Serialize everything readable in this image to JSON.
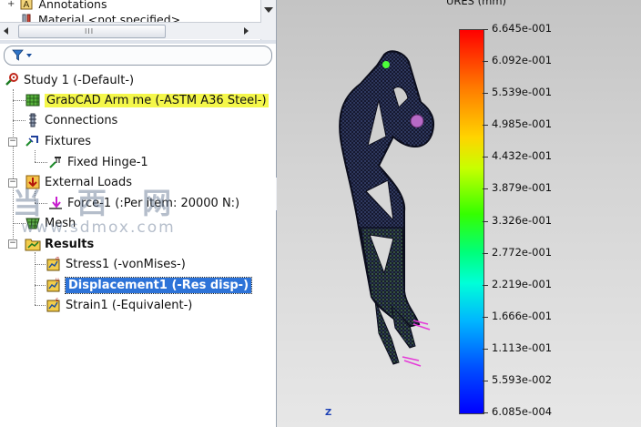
{
  "top_list": {
    "items": [
      {
        "label": "Annotations",
        "icon": "annotation-icon"
      },
      {
        "label": "Material <not specified>",
        "icon": "material-icon"
      }
    ],
    "hscroll_grip": "III"
  },
  "filter": {
    "icon": "filter-funnel-icon"
  },
  "tree": {
    "study": "Study 1 (-Default-)",
    "part": "GrabCAD Arm me (-ASTM A36 Steel-)",
    "connections": "Connections",
    "fixtures": "Fixtures",
    "fixed_hinge": "Fixed Hinge-1",
    "external_loads": "External Loads",
    "force": "Force-1 (:Per item: 20000 N:)",
    "mesh": "Mesh",
    "results": "Results",
    "stress": "Stress1 (-vonMises-)",
    "displacement": "Displacement1 (-Res disp-)",
    "strain": "Strain1 (-Equivalent-)"
  },
  "legend": {
    "title": "URES (mm)",
    "labels": [
      "6.645e-001",
      "6.092e-001",
      "5.539e-001",
      "4.985e-001",
      "4.432e-001",
      "3.879e-001",
      "3.326e-001",
      "2.772e-001",
      "2.219e-001",
      "1.666e-001",
      "1.113e-001",
      "5.593e-002",
      "6.085e-004"
    ],
    "colors": {
      "max": "#ff0000",
      "min": "#0000ff"
    }
  },
  "triad": {
    "axis": "Z"
  },
  "watermark": {
    "text": "当 西 网",
    "url": "www.sdmox.com"
  },
  "colors": {
    "highlight": "#f4f74a",
    "selection": "#2d73d8",
    "model_mesh": "#1a1d3a"
  }
}
